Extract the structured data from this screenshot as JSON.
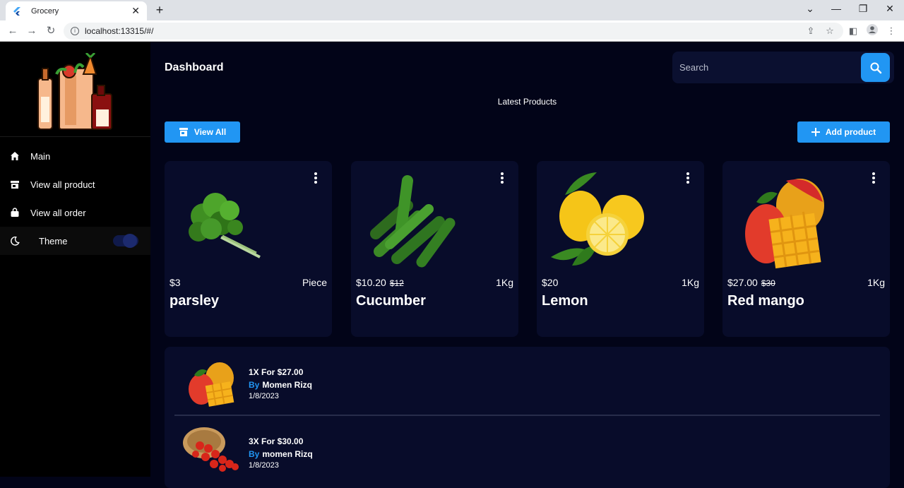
{
  "browser": {
    "tab_title": "Grocery",
    "tab_close": "✕",
    "new_tab": "+",
    "url": "localhost:13315/#/"
  },
  "sidebar": {
    "items": [
      {
        "label": "Main",
        "icon": "home-icon"
      },
      {
        "label": "View all product",
        "icon": "store-icon"
      },
      {
        "label": "View all order",
        "icon": "bag-icon"
      },
      {
        "label": "Theme",
        "icon": "moon-icon"
      }
    ],
    "theme_toggle_on": true
  },
  "header": {
    "title": "Dashboard",
    "search_placeholder": "Search"
  },
  "latest": {
    "title": "Latest Products",
    "view_all_label": "View All",
    "add_product_label": "Add product"
  },
  "products": [
    {
      "price": "$3",
      "old_price": "",
      "unit": "Piece",
      "name": "parsley"
    },
    {
      "price": "$10.20",
      "old_price": "$12",
      "unit": "1Kg",
      "name": "Cucumber"
    },
    {
      "price": "$20",
      "old_price": "",
      "unit": "1Kg",
      "name": "Lemon"
    },
    {
      "price": "$27.00",
      "old_price": "$30",
      "unit": "1Kg",
      "name": "Red mango"
    }
  ],
  "orders": [
    {
      "summary": "1X For $27.00",
      "by": "By",
      "customer": "Momen Rizq",
      "date": "1/8/2023"
    },
    {
      "summary": "3X For $30.00",
      "by": "By",
      "customer": "momen Rizq",
      "date": "1/8/2023"
    }
  ],
  "colors": {
    "accent": "#2196f3",
    "background": "#020418",
    "card": "#080c2a",
    "sidebar": "#000000"
  }
}
